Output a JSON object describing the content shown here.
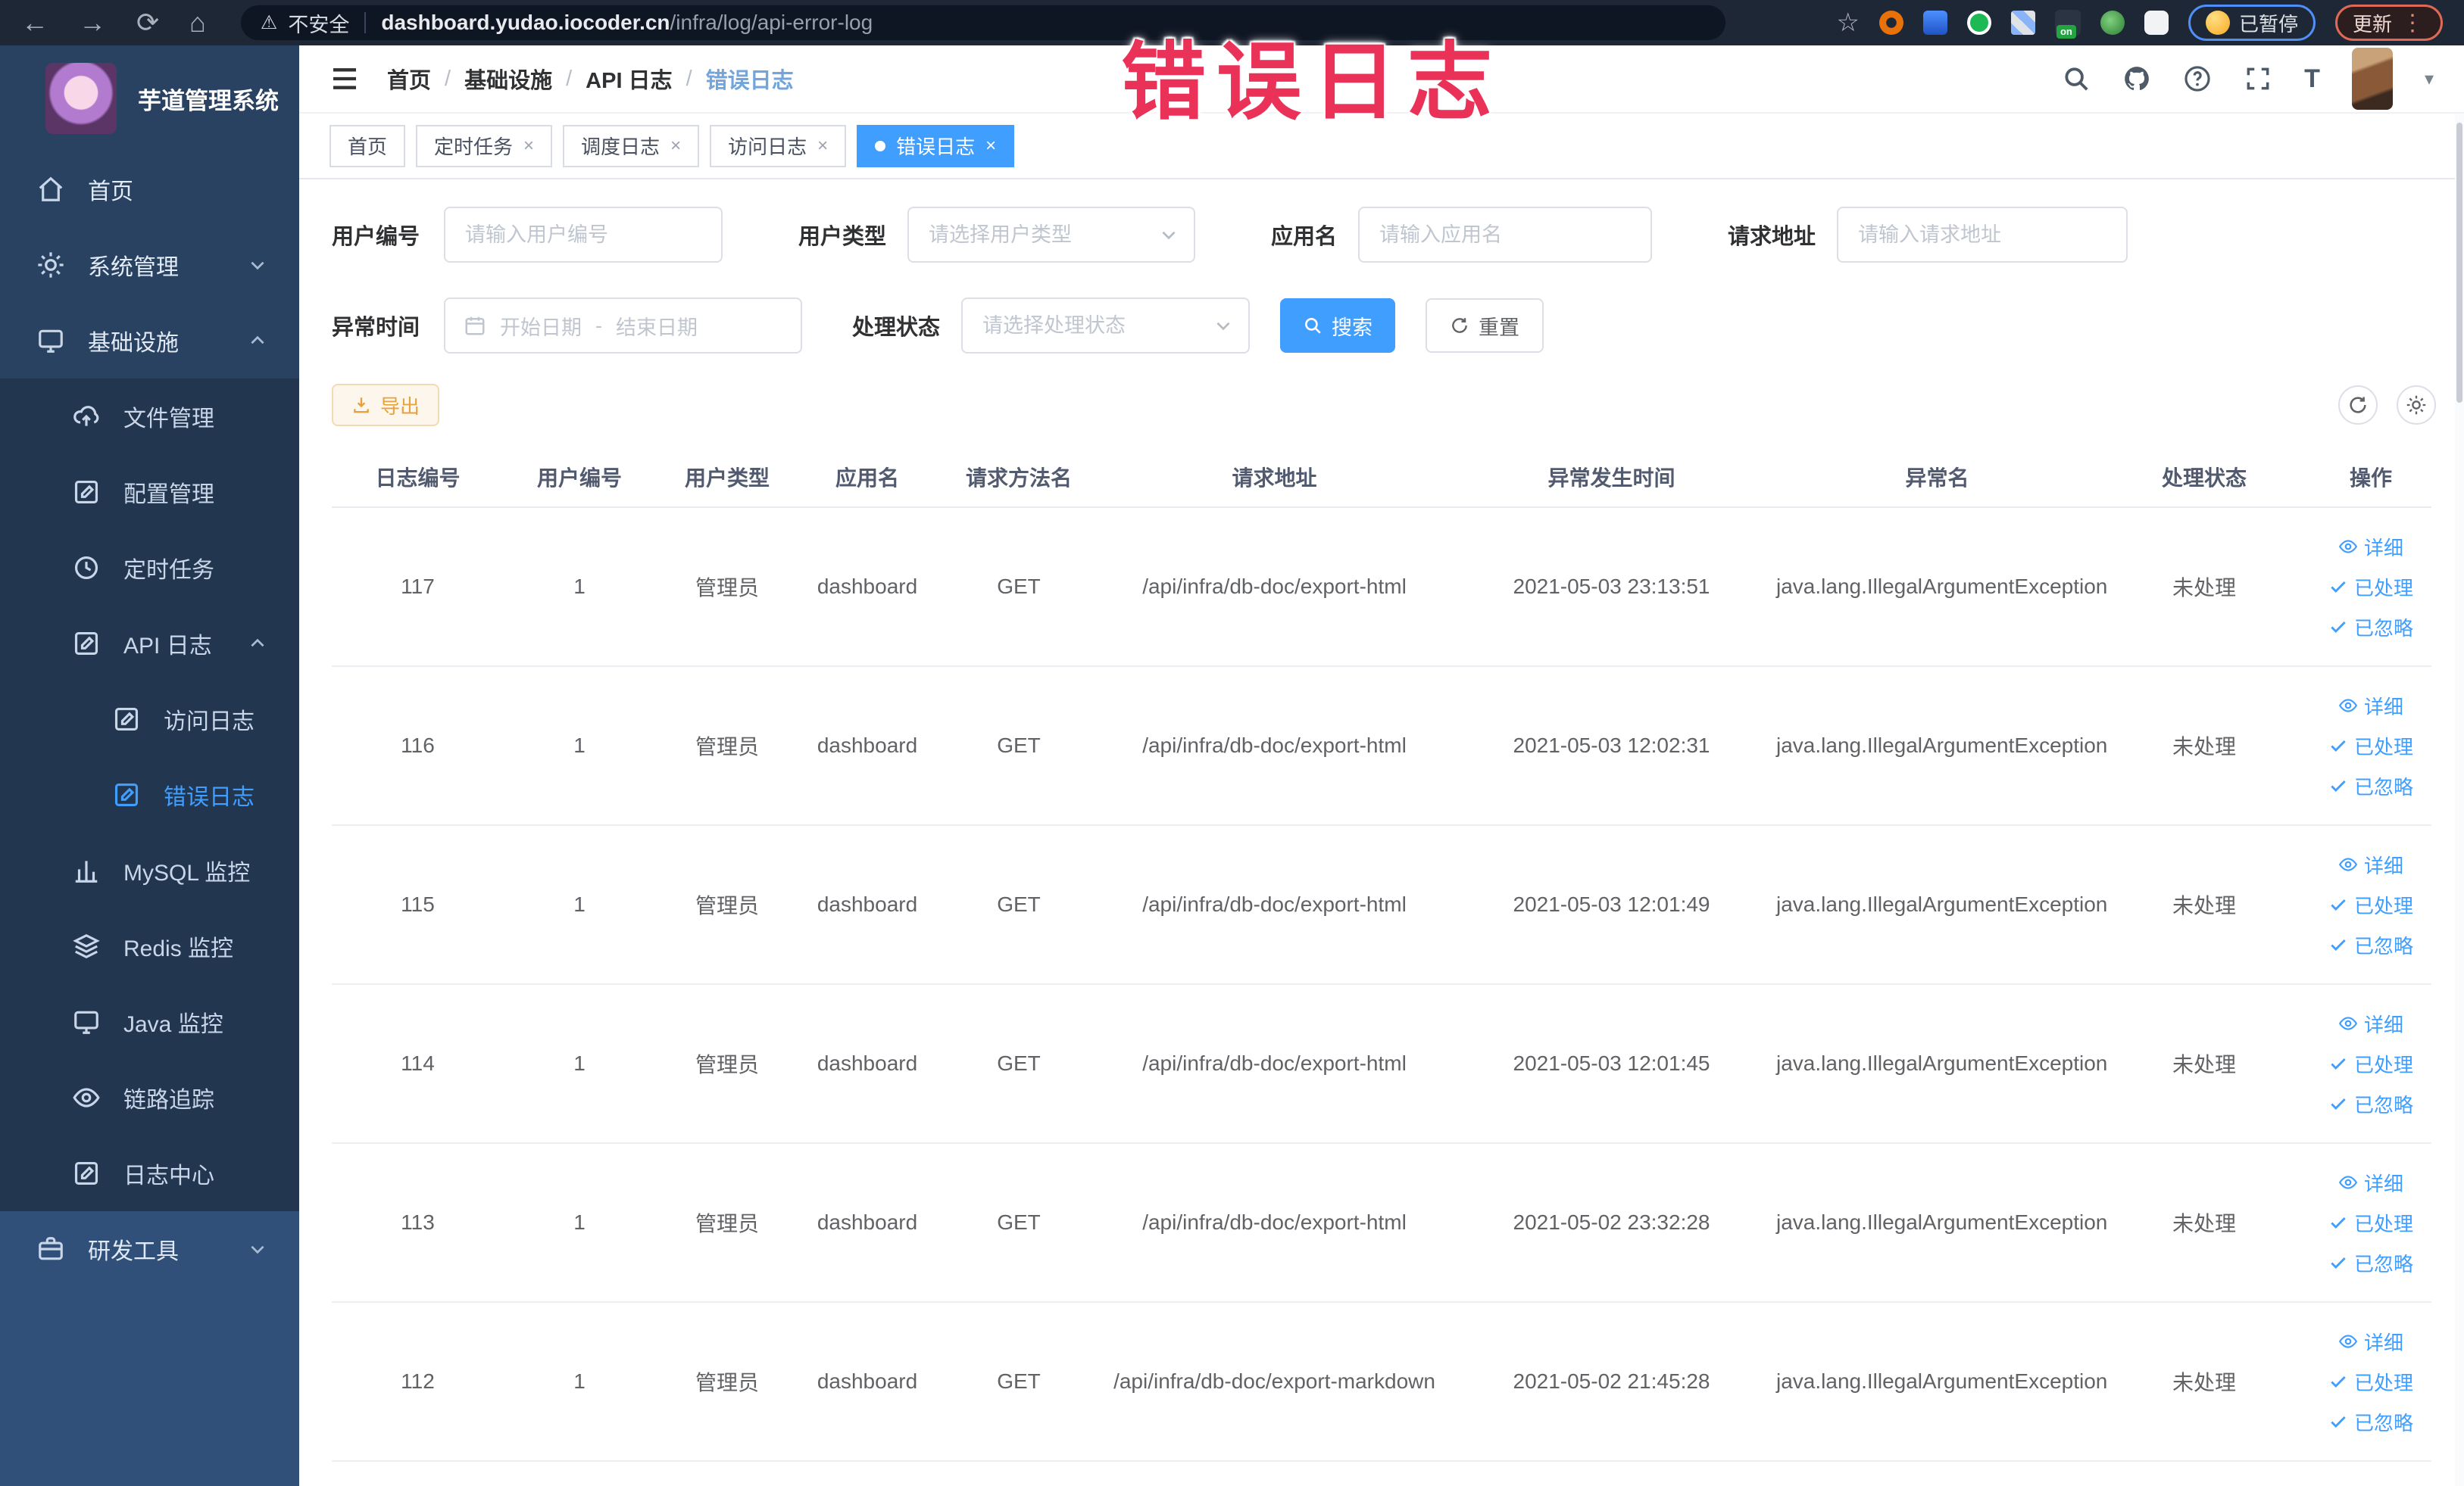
{
  "browser": {
    "security_label": "不安全",
    "url_host": "dashboard.yudao.iocoder.cn",
    "url_path": "/infra/log/api-error-log",
    "on_label": "on",
    "paused_label": "已暂停",
    "update_label": "更新"
  },
  "overlay_title": "错误日志",
  "sidebar": {
    "app_title": "芋道管理系统",
    "items": [
      {
        "label": "首页"
      },
      {
        "label": "系统管理"
      },
      {
        "label": "基础设施"
      },
      {
        "label": "文件管理"
      },
      {
        "label": "配置管理"
      },
      {
        "label": "定时任务"
      },
      {
        "label": "API 日志"
      },
      {
        "label": "访问日志"
      },
      {
        "label": "错误日志"
      },
      {
        "label": "MySQL 监控"
      },
      {
        "label": "Redis 监控"
      },
      {
        "label": "Java 监控"
      },
      {
        "label": "链路追踪"
      },
      {
        "label": "日志中心"
      },
      {
        "label": "研发工具"
      }
    ]
  },
  "breadcrumb": [
    "首页",
    "基础设施",
    "API 日志",
    "错误日志"
  ],
  "tabs": [
    {
      "label": "首页"
    },
    {
      "label": "定时任务"
    },
    {
      "label": "调度日志"
    },
    {
      "label": "访问日志"
    },
    {
      "label": "错误日志"
    }
  ],
  "filters": {
    "user_id_label": "用户编号",
    "user_id_placeholder": "请输入用户编号",
    "user_type_label": "用户类型",
    "user_type_placeholder": "请选择用户类型",
    "app_name_label": "应用名",
    "app_name_placeholder": "请输入应用名",
    "request_url_label": "请求地址",
    "request_url_placeholder": "请输入请求地址",
    "time_label": "异常时间",
    "time_start_placeholder": "开始日期",
    "time_separator": "-",
    "time_end_placeholder": "结束日期",
    "status_label": "处理状态",
    "status_placeholder": "请选择处理状态",
    "search_label": "搜索",
    "reset_label": "重置"
  },
  "toolbar": {
    "export_label": "导出"
  },
  "table": {
    "columns": [
      "日志编号",
      "用户编号",
      "用户类型",
      "应用名",
      "请求方法名",
      "请求地址",
      "异常发生时间",
      "异常名",
      "处理状态",
      "操作"
    ],
    "action_labels": [
      "详细",
      "已处理",
      "已忽略"
    ],
    "rows": [
      {
        "id": "117",
        "user_id": "1",
        "user_type": "管理员",
        "app": "dashboard",
        "method": "GET",
        "url": "/api/infra/db-doc/export-html",
        "time": "2021-05-03 23:13:51",
        "exception": "java.lang.IllegalArgumentException",
        "status": "未处理"
      },
      {
        "id": "116",
        "user_id": "1",
        "user_type": "管理员",
        "app": "dashboard",
        "method": "GET",
        "url": "/api/infra/db-doc/export-html",
        "time": "2021-05-03 12:02:31",
        "exception": "java.lang.IllegalArgumentException",
        "status": "未处理"
      },
      {
        "id": "115",
        "user_id": "1",
        "user_type": "管理员",
        "app": "dashboard",
        "method": "GET",
        "url": "/api/infra/db-doc/export-html",
        "time": "2021-05-03 12:01:49",
        "exception": "java.lang.IllegalArgumentException",
        "status": "未处理"
      },
      {
        "id": "114",
        "user_id": "1",
        "user_type": "管理员",
        "app": "dashboard",
        "method": "GET",
        "url": "/api/infra/db-doc/export-html",
        "time": "2021-05-03 12:01:45",
        "exception": "java.lang.IllegalArgumentException",
        "status": "未处理"
      },
      {
        "id": "113",
        "user_id": "1",
        "user_type": "管理员",
        "app": "dashboard",
        "method": "GET",
        "url": "/api/infra/db-doc/export-html",
        "time": "2021-05-02 23:32:28",
        "exception": "java.lang.IllegalArgumentException",
        "status": "未处理"
      },
      {
        "id": "112",
        "user_id": "1",
        "user_type": "管理员",
        "app": "dashboard",
        "method": "GET",
        "url": "/api/infra/db-doc/export-markdown",
        "time": "2021-05-02 21:45:28",
        "exception": "java.lang.IllegalArgumentException",
        "status": "未处理"
      }
    ]
  },
  "icons": {
    "back": "←",
    "forward": "→",
    "reload": "⟳",
    "home": "⌂",
    "star": "☆",
    "warning": "⚠",
    "dots": "⋮",
    "caret": "▾",
    "slash": "/",
    "close": "×",
    "question": "?",
    "fontsize": "T"
  },
  "colors": {
    "accent": "#409EFF",
    "warning": "#E6A23C",
    "overlay_pink": "#EA3158",
    "browser_bar_bg": "#1E2735",
    "sidebar_bg": "#2A4262",
    "submenu_bg": "#223650",
    "sidebar_bottom_bg": "#305079",
    "paused_blue": "#4F8FF7",
    "update_red": "#DD6A56"
  }
}
